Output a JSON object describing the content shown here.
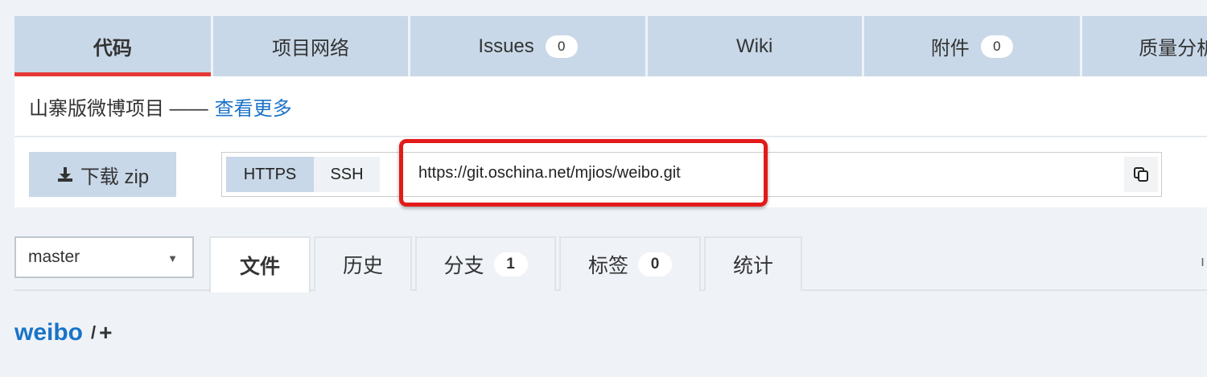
{
  "top_tabs": [
    {
      "label": "代码",
      "active": true
    },
    {
      "label": "项目网络"
    },
    {
      "label": "Issues",
      "count": "0"
    },
    {
      "label": "Wiki"
    },
    {
      "label": "附件",
      "count": "0"
    },
    {
      "label": "质量分析"
    }
  ],
  "description": {
    "text": "山寨版微博项目 ——",
    "more_link": "查看更多"
  },
  "clone": {
    "download_label": "下载 zip",
    "protocols": [
      "HTTPS",
      "SSH"
    ],
    "url": "https://git.oschina.net/mjios/weibo.git"
  },
  "branch": {
    "selected": "master"
  },
  "file_tabs": [
    {
      "label": "文件"
    },
    {
      "label": "历史"
    },
    {
      "label": "分支",
      "count": "1"
    },
    {
      "label": "标签",
      "count": "0"
    },
    {
      "label": "统计"
    }
  ],
  "path": {
    "repo": "weibo",
    "separator": "/",
    "add": "+"
  },
  "colors": {
    "accent": "#1a73c8",
    "tab_bg": "#c8d8e8",
    "active_underline": "#e53935",
    "highlight": "#e21a1a"
  }
}
